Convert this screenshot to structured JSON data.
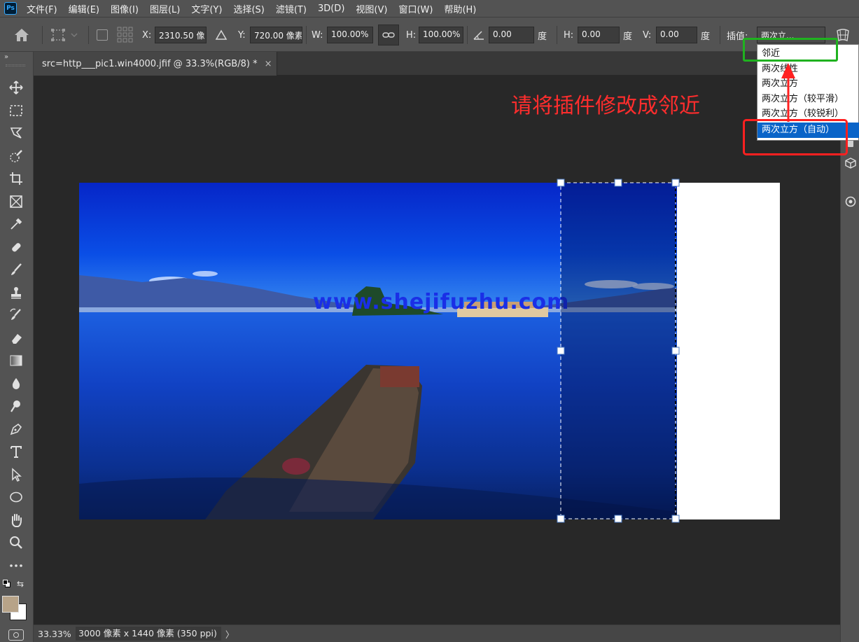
{
  "app": {
    "logo_text": "Ps",
    "menus": [
      "文件(F)",
      "编辑(E)",
      "图像(I)",
      "图层(L)",
      "文字(Y)",
      "选择(S)",
      "滤镜(T)",
      "3D(D)",
      "视图(V)",
      "窗口(W)",
      "帮助(H)"
    ]
  },
  "options": {
    "x_label": "X:",
    "x_value": "2310.50 像",
    "y_label": "Y:",
    "y_value": "720.00 像素",
    "w_label": "W:",
    "w_value": "100.00%",
    "h_label": "H:",
    "h_value": "100.00%",
    "angle_value": "0.00",
    "angle_unit": "度",
    "hskew_label": "H:",
    "hskew_value": "0.00",
    "hskew_unit": "度",
    "vskew_label": "V:",
    "vskew_value": "0.00",
    "vskew_unit": "度",
    "interp_label": "插值:",
    "interp_value": "两次立..."
  },
  "document_tab": {
    "title": "src=http___pic1.win4000.jfif @ 33.3%(RGB/8) *",
    "close": "×"
  },
  "dropdown": {
    "items": [
      "邻近",
      "两次线性",
      "两次立方",
      "两次立方（较平滑）",
      "两次立方（较锐利）",
      "两次立方（自动）"
    ],
    "selected_index": 5
  },
  "annotation": {
    "text": "请将插件修改成邻近",
    "color": "#ff2d2d",
    "green_box_color": "#1fb21f",
    "red_box_color": "#ff2020"
  },
  "canvas": {
    "watermark": "www.shejifuzhu.com"
  },
  "status": {
    "zoom": "33.33%",
    "doc_info": "3000 像素 x 1440 像素 (350 ppi)",
    "arrow": "〉"
  },
  "colors": {
    "foreground_swatch": "#b7a388",
    "background_swatch": "#ffffff",
    "accent": "#0a64c8"
  }
}
